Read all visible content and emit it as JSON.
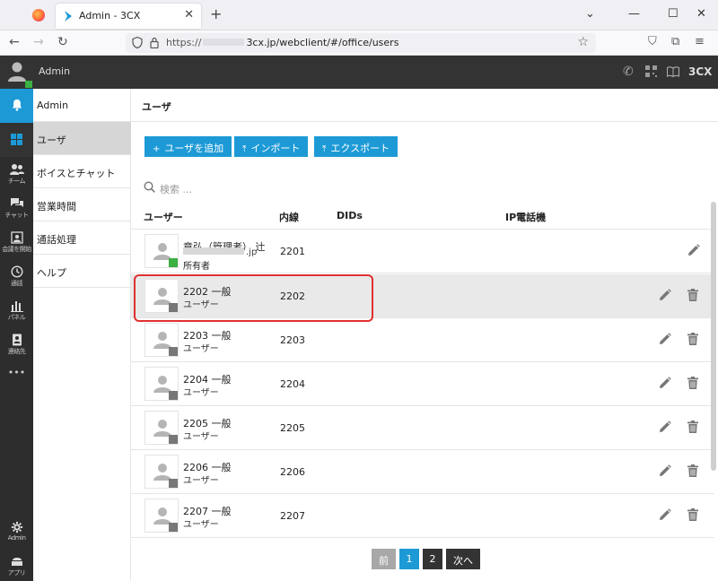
{
  "browser": {
    "tab_title": "Admin - 3CX",
    "tab_close": "✕",
    "new_tab": "+",
    "url_prefix": "https://",
    "url_rest": "3cx.jp/webclient/#/office/users",
    "window_controls": [
      "⌄",
      "—",
      "☐",
      "✕"
    ]
  },
  "header": {
    "user_name": "Admin",
    "brand": "3CX"
  },
  "rail": {
    "items": [
      {
        "label": "",
        "icon": "bell-icon"
      },
      {
        "label": "",
        "icon": "windows-icon"
      },
      {
        "label": "チーム",
        "icon": "team-icon"
      },
      {
        "label": "チャット",
        "icon": "chat-icon"
      },
      {
        "label": "会議を開始",
        "icon": "meeting-icon"
      },
      {
        "label": "通話",
        "icon": "history-icon"
      },
      {
        "label": "パネル",
        "icon": "panel-icon"
      },
      {
        "label": "連絡先",
        "icon": "contacts-icon"
      },
      {
        "label": "•••",
        "icon": "more-icon"
      }
    ],
    "bottom": [
      {
        "label": "Admin",
        "icon": "gear-icon"
      },
      {
        "label": "アプリ",
        "icon": "apps-icon"
      }
    ]
  },
  "subnav": {
    "items": [
      "Admin",
      "ユーザ",
      "ボイスとチャット",
      "営業時間",
      "通話処理",
      "ヘルプ"
    ],
    "active_index": 1
  },
  "main": {
    "title": "ユーザ",
    "buttons": {
      "add": "ユーザを追加",
      "import": "インポート",
      "export": "エクスポート"
    },
    "search_placeholder": "検索 ...",
    "columns": {
      "user": "ユーザー",
      "ext": "内線",
      "dids": "DIDs",
      "ipphone": "IP電話機"
    },
    "owner": {
      "name": "章弘（管理者） 辻",
      "email_suffix": ".jp",
      "role": "所有者",
      "ext": "2201"
    },
    "rows": [
      {
        "name": "2202 一般",
        "role": "ユーザー",
        "ext": "2202"
      },
      {
        "name": "2203 一般",
        "role": "ユーザー",
        "ext": "2203"
      },
      {
        "name": "2204 一般",
        "role": "ユーザー",
        "ext": "2204"
      },
      {
        "name": "2205 一般",
        "role": "ユーザー",
        "ext": "2205"
      },
      {
        "name": "2206 一般",
        "role": "ユーザー",
        "ext": "2206"
      },
      {
        "name": "2207 一般",
        "role": "ユーザー",
        "ext": "2207"
      }
    ],
    "pager": {
      "prev": "前",
      "page1": "1",
      "page2": "2",
      "next": "次へ"
    }
  }
}
